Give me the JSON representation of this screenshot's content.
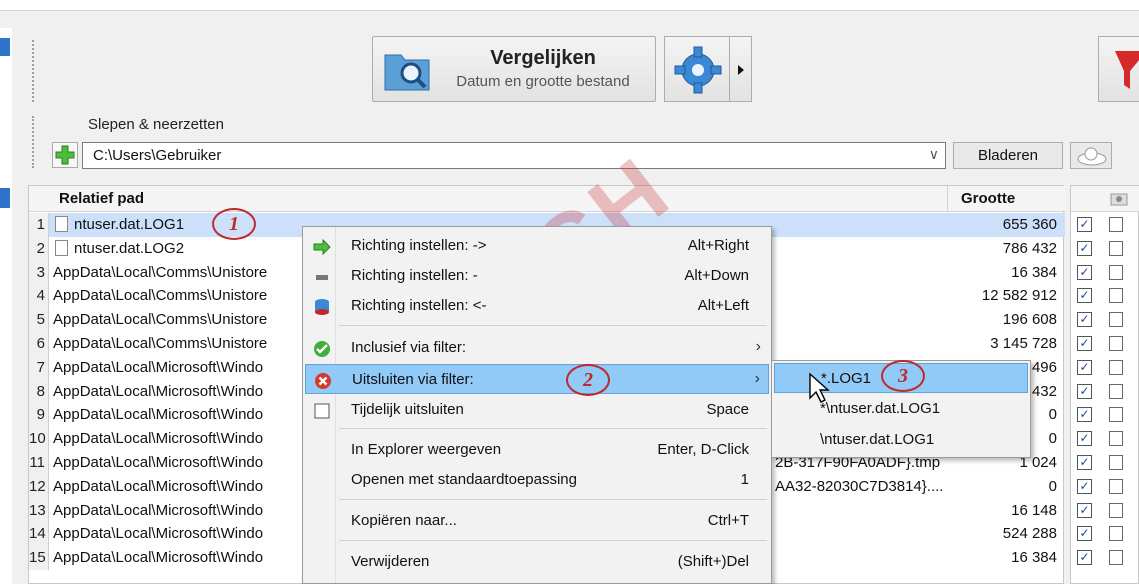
{
  "toolbar": {
    "compare_title": "Vergelijken",
    "compare_subtitle": "Datum en grootte bestand"
  },
  "path_bar": {
    "label": "Slepen & neerzetten",
    "path": "C:\\Users\\Gebruiker",
    "browse_label": "Bladeren"
  },
  "table": {
    "col_path": "Relatief pad",
    "col_size": "Grootte",
    "rows": [
      {
        "num": "1",
        "path": "ntuser.dat.LOG1",
        "size": "655 360",
        "extra": ""
      },
      {
        "num": "2",
        "path": "ntuser.dat.LOG2",
        "size": "786 432",
        "extra": ""
      },
      {
        "num": "3",
        "path": "AppData\\Local\\Comms\\Unistore",
        "size": "16 384",
        "extra": ""
      },
      {
        "num": "4",
        "path": "AppData\\Local\\Comms\\Unistore",
        "size": "12 582 912",
        "extra": ""
      },
      {
        "num": "5",
        "path": "AppData\\Local\\Comms\\Unistore",
        "size": "196 608",
        "extra": ""
      },
      {
        "num": "6",
        "path": "AppData\\Local\\Comms\\Unistore",
        "size": "3 145 728",
        "extra": ""
      },
      {
        "num": "7",
        "path": "AppData\\Local\\Microsoft\\Windo",
        "size": "496",
        "extra": ""
      },
      {
        "num": "8",
        "path": "AppData\\Local\\Microsoft\\Windo",
        "size": "432",
        "extra": ""
      },
      {
        "num": "9",
        "path": "AppData\\Local\\Microsoft\\Windo",
        "size": "0",
        "extra": ""
      },
      {
        "num": "10",
        "path": "AppData\\Local\\Microsoft\\Windo",
        "size": "0",
        "extra": ""
      },
      {
        "num": "11",
        "path": "AppData\\Local\\Microsoft\\Windo",
        "size": "1 024",
        "extra": "2B-317F90FA0ADF}.tmp"
      },
      {
        "num": "12",
        "path": "AppData\\Local\\Microsoft\\Windo",
        "size": "0",
        "extra": "AA32-82030C7D3814}...."
      },
      {
        "num": "13",
        "path": "AppData\\Local\\Microsoft\\Windo",
        "size": "16 148",
        "extra": ""
      },
      {
        "num": "14",
        "path": "AppData\\Local\\Microsoft\\Windo",
        "size": "524 288",
        "extra": ""
      },
      {
        "num": "15",
        "path": "AppData\\Local\\Microsoft\\Windo",
        "size": "16 384",
        "extra": ""
      }
    ]
  },
  "context_menu": {
    "items": [
      {
        "label": "Richting instellen: ->",
        "shortcut": "Alt+Right"
      },
      {
        "label": "Richting instellen: -",
        "shortcut": "Alt+Down"
      },
      {
        "label": "Richting instellen: <-",
        "shortcut": "Alt+Left"
      },
      {
        "label": "Inclusief via filter:",
        "shortcut": ""
      },
      {
        "label": "Uitsluiten via filter:",
        "shortcut": ""
      },
      {
        "label": "Tijdelijk uitsluiten",
        "shortcut": "Space"
      },
      {
        "label": "In Explorer weergeven",
        "shortcut": "Enter, D-Click"
      },
      {
        "label": "Openen met standaardtoepassing",
        "shortcut": "1"
      },
      {
        "label": "Kopiëren naar...",
        "shortcut": "Ctrl+T"
      },
      {
        "label": "Verwijderen",
        "shortcut": "(Shift+)Del"
      }
    ]
  },
  "submenu": {
    "items": [
      "*.LOG1",
      "*\\ntuser.dat.LOG1",
      "\\ntuser.dat.LOG1"
    ]
  },
  "annotations": {
    "callout_1": "1",
    "callout_2": "2",
    "callout_3": "3",
    "watermark": "PCH"
  },
  "colors": {
    "selection": "#cce0fa",
    "menu_highlight": "#91c9f7",
    "annotation_red": "#c0282a",
    "accent_blue": "#2b74c9"
  }
}
